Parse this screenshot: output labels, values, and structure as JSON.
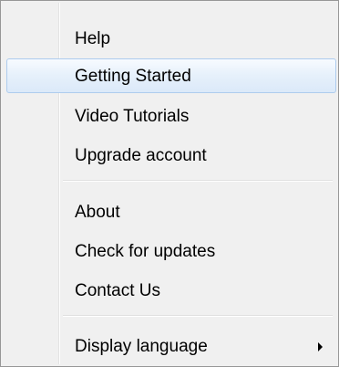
{
  "menu": {
    "items": [
      {
        "label": "Help"
      },
      {
        "label": "Getting Started"
      },
      {
        "label": "Video Tutorials"
      },
      {
        "label": "Upgrade account"
      },
      {
        "label": "About"
      },
      {
        "label": "Check for updates"
      },
      {
        "label": "Contact Us"
      },
      {
        "label": "Display language"
      }
    ],
    "highlighted_item": "Getting Started",
    "submenu_arrow_icon": "chevron-right-icon",
    "colors": {
      "background": "#f0f0f0",
      "border": "#979797",
      "highlight_border": "#aeccee",
      "highlight_fill": "#dbe9f9",
      "text": "#000000"
    }
  }
}
